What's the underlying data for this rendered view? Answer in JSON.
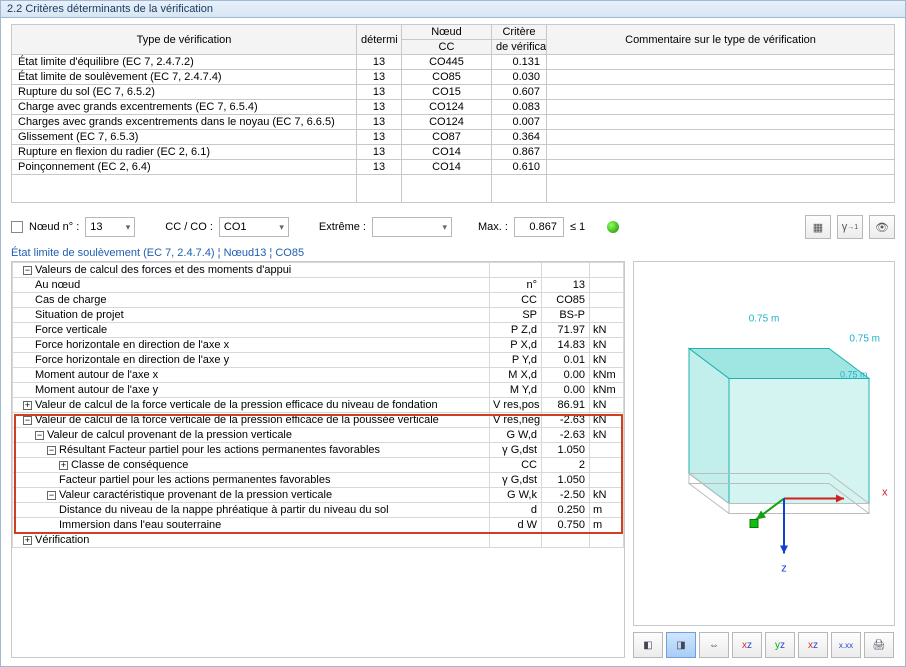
{
  "window_title": "2.2 Critères déterminants de la vérification",
  "table": {
    "headers": {
      "type": "Type de vérification",
      "det": "détermi",
      "node_group": "Nœud",
      "cc": "CC",
      "crit_group": "Critère",
      "crit": "de vérificat",
      "comment": "Commentaire sur le type de vérification"
    },
    "rows": [
      {
        "type": "État limite d'équilibre (EC 7, 2.4.7.2)",
        "det": "13",
        "cc": "CO445",
        "crit": "0.131"
      },
      {
        "type": "État limite de soulèvement (EC 7, 2.4.7.4)",
        "det": "13",
        "cc": "CO85",
        "crit": "0.030"
      },
      {
        "type": "Rupture du sol (EC 7, 6.5.2)",
        "det": "13",
        "cc": "CO15",
        "crit": "0.607"
      },
      {
        "type": "Charge avec grands excentrements (EC 7, 6.5.4)",
        "det": "13",
        "cc": "CO124",
        "crit": "0.083"
      },
      {
        "type": "Charges avec grands excentrements dans le noyau (EC 7, 6.6.5)",
        "det": "13",
        "cc": "CO124",
        "crit": "0.007"
      },
      {
        "type": "Glissement (EC 7, 6.5.3)",
        "det": "13",
        "cc": "CO87",
        "crit": "0.364"
      },
      {
        "type": "Rupture en flexion du radier (EC 2, 6.1)",
        "det": "13",
        "cc": "CO14",
        "crit": "0.867"
      },
      {
        "type": "Poinçonnement (EC 2, 6.4)",
        "det": "13",
        "cc": "CO14",
        "crit": "0.610"
      }
    ]
  },
  "filter": {
    "node_label": "Nœud n° :",
    "node_value": "13",
    "ccco_label": "CC / CO :",
    "ccco_value": "CO1",
    "extreme_label": "Extrême :",
    "extreme_value": "",
    "max_label": "Max. :",
    "max_value": "0.867",
    "max_limit": "≤ 1"
  },
  "subtitle": "État limite de soulèvement (EC 7, 2.4.7.4) ¦ Nœud13 ¦ CO85",
  "tree": [
    {
      "lvl": 0,
      "tg": "-",
      "label": "Valeurs de calcul des forces et des moments d'appui",
      "sym": "",
      "val": "",
      "unit": ""
    },
    {
      "lvl": 1,
      "tg": "",
      "label": "Au nœud",
      "sym": "n°",
      "val": "13",
      "unit": ""
    },
    {
      "lvl": 1,
      "tg": "",
      "label": "Cas de charge",
      "sym": "CC",
      "val": "CO85",
      "unit": ""
    },
    {
      "lvl": 1,
      "tg": "",
      "label": "Situation de projet",
      "sym": "SP",
      "val": "BS-P",
      "unit": ""
    },
    {
      "lvl": 1,
      "tg": "",
      "label": "Force verticale",
      "sym": "P Z,d",
      "val": "71.97",
      "unit": "kN"
    },
    {
      "lvl": 1,
      "tg": "",
      "label": "Force horizontale en direction de l'axe x",
      "sym": "P X,d",
      "val": "14.83",
      "unit": "kN"
    },
    {
      "lvl": 1,
      "tg": "",
      "label": "Force horizontale en direction de l'axe y",
      "sym": "P Y,d",
      "val": "0.01",
      "unit": "kN"
    },
    {
      "lvl": 1,
      "tg": "",
      "label": "Moment autour de l'axe x",
      "sym": "M X,d",
      "val": "0.00",
      "unit": "kNm"
    },
    {
      "lvl": 1,
      "tg": "",
      "label": "Moment autour de l'axe y",
      "sym": "M Y,d",
      "val": "0.00",
      "unit": "kNm"
    },
    {
      "lvl": 0,
      "tg": "+",
      "label": "Valeur de calcul de la force verticale de la pression efficace du niveau de fondation",
      "sym": "V res,pos",
      "val": "86.91",
      "unit": "kN"
    },
    {
      "lvl": 0,
      "tg": "-",
      "label": "Valeur de calcul de la force verticale de la pression efficace de la poussée verticale",
      "sym": "V res,neg",
      "val": "-2.63",
      "unit": "kN",
      "hl": true
    },
    {
      "lvl": 1,
      "tg": "-",
      "label": "Valeur de calcul provenant de la pression verticale",
      "sym": "G W,d",
      "val": "-2.63",
      "unit": "kN",
      "hl": true
    },
    {
      "lvl": 2,
      "tg": "-",
      "label": "Résultant Facteur partiel pour les actions permanentes favorables",
      "sym": "γ G,dst",
      "val": "1.050",
      "unit": "",
      "hl": true
    },
    {
      "lvl": 3,
      "tg": "+",
      "label": "Classe de conséquence",
      "sym": "CC",
      "val": "2",
      "unit": "",
      "hl": true
    },
    {
      "lvl": 3,
      "tg": "",
      "label": "Facteur partiel pour les actions permanentes favorables",
      "sym": "γ G,dst",
      "val": "1.050",
      "unit": "",
      "hl": true
    },
    {
      "lvl": 2,
      "tg": "-",
      "label": "Valeur caractéristique provenant de la pression verticale",
      "sym": "G W,k",
      "val": "-2.50",
      "unit": "kN",
      "hl": true
    },
    {
      "lvl": 3,
      "tg": "",
      "label": "Distance du niveau de la nappe phréatique à partir du niveau du sol",
      "sym": "d",
      "val": "0.250",
      "unit": "m",
      "hl": true
    },
    {
      "lvl": 3,
      "tg": "",
      "label": "Immersion dans l'eau souterraine",
      "sym": "d W",
      "val": "0.750",
      "unit": "m",
      "hl": true
    },
    {
      "lvl": 0,
      "tg": "+",
      "label": "Vérification",
      "sym": "",
      "val": "",
      "unit": ""
    }
  ],
  "viewer": {
    "dim_top": "0.75 m",
    "dim_right": "0.75 m",
    "dim_back": "0.75 m",
    "axis_x": "x",
    "axis_z": "z"
  },
  "viewer_buttons": [
    "iso",
    "persp",
    "stretch",
    "xz",
    "yz",
    "xy",
    "xxx",
    "print"
  ],
  "toolbar_icons": [
    "grid-icon",
    "gamma-icon",
    "eye-icon"
  ]
}
